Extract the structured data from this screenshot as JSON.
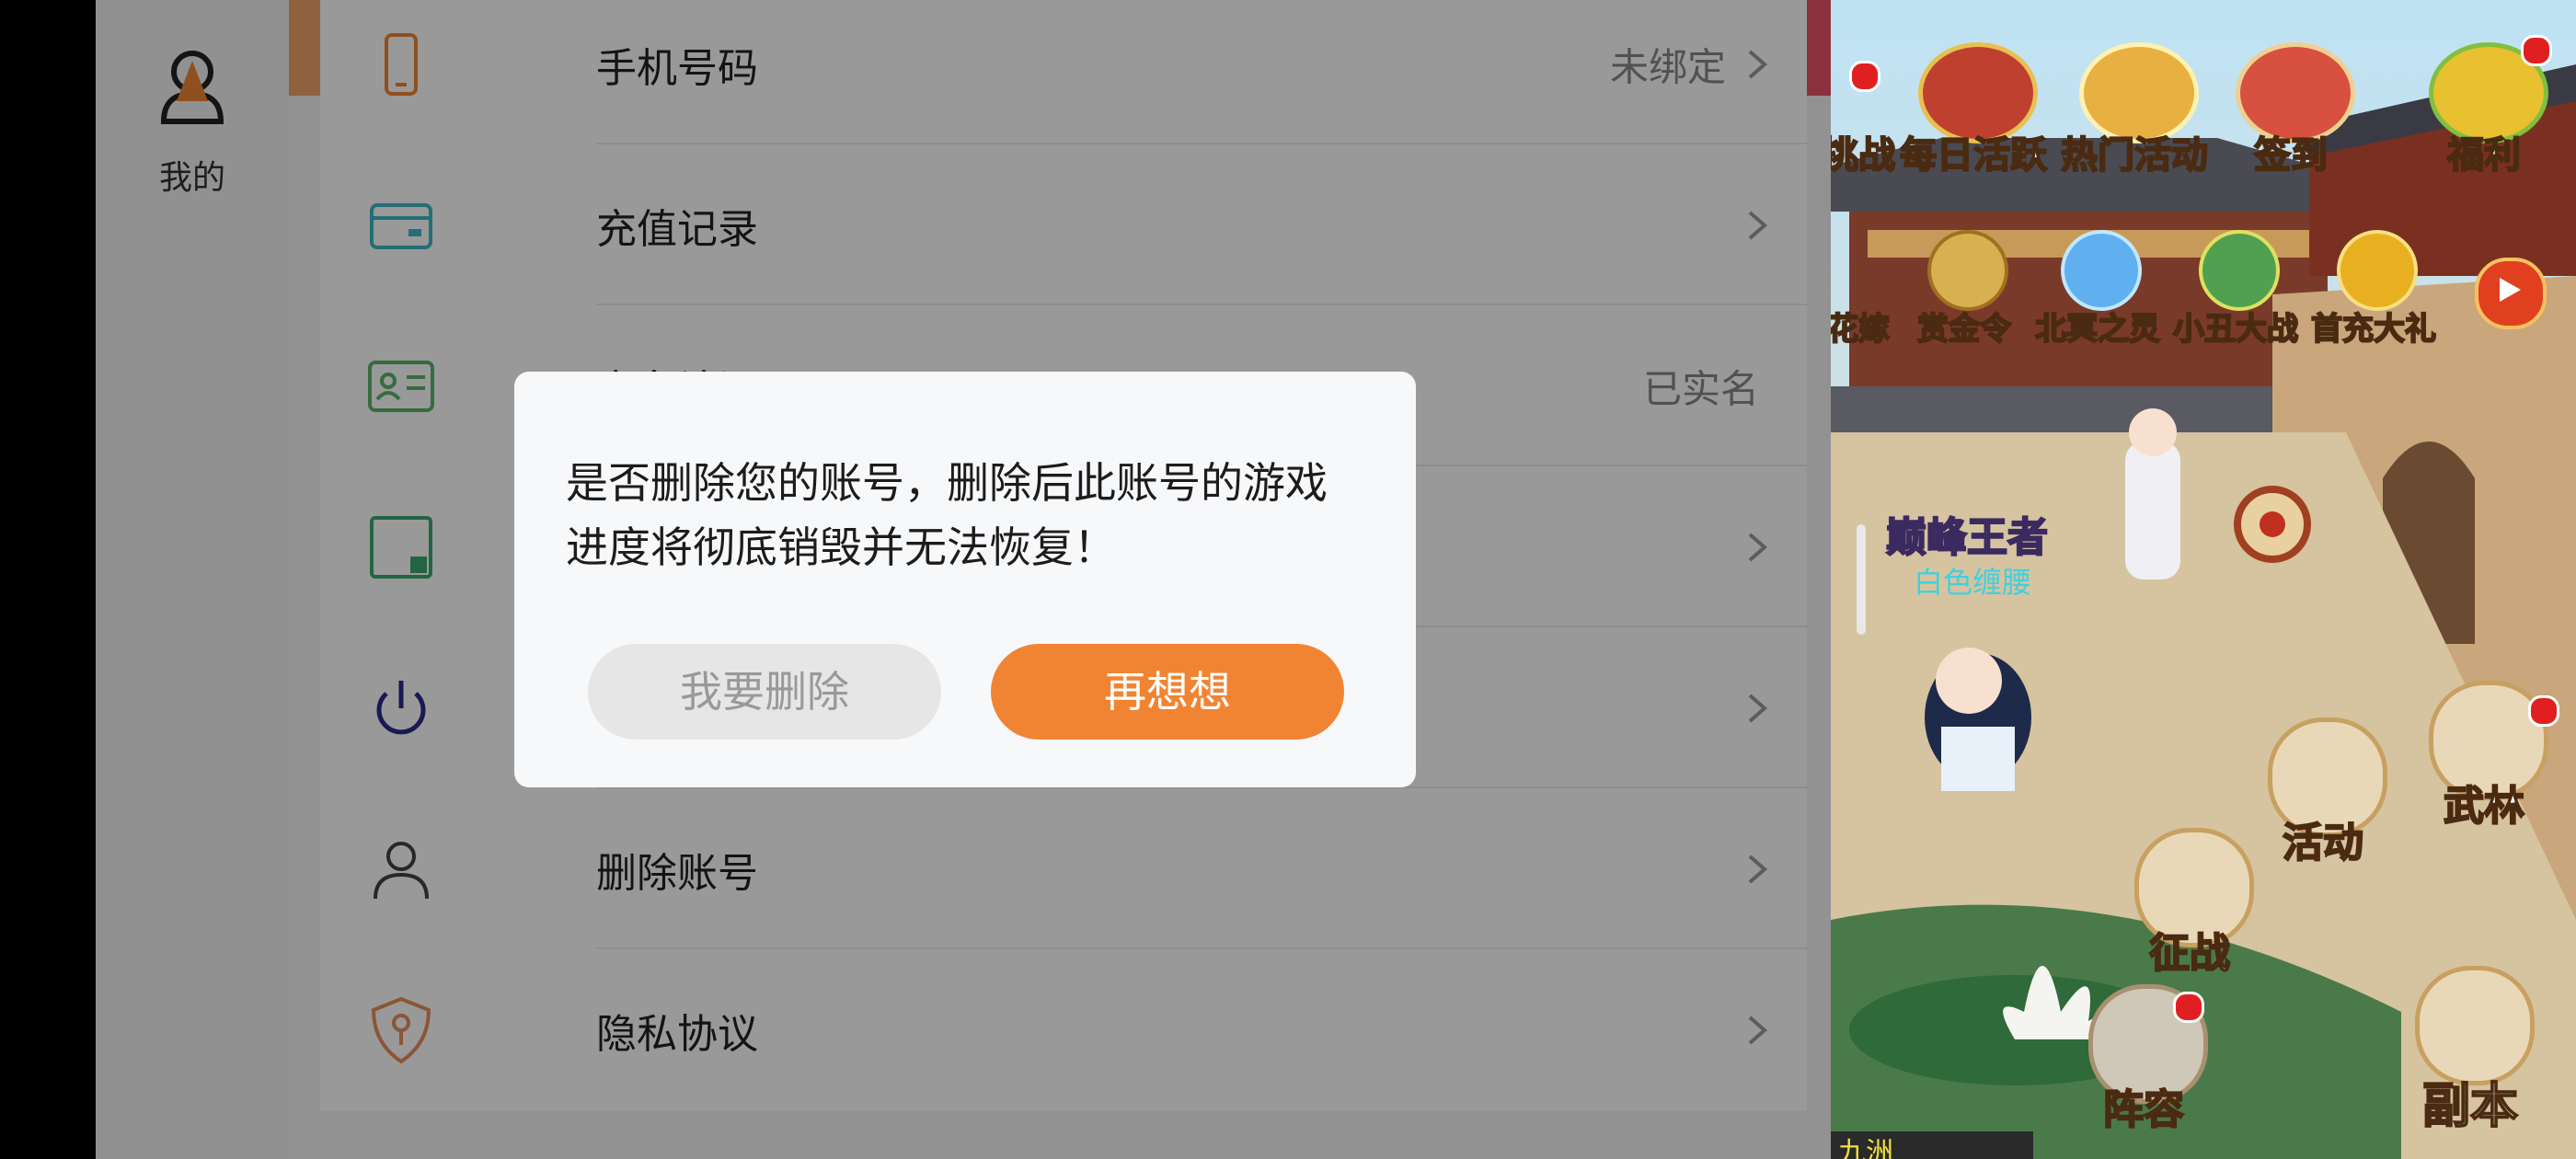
{
  "sidebar": {
    "me_label": "我的"
  },
  "settings": {
    "rows": [
      {
        "label": "手机号码",
        "value": "未绑定"
      },
      {
        "label": "充值记录",
        "value": ""
      },
      {
        "label": "实名认证",
        "value": "已实名"
      },
      {
        "label": "",
        "value": ""
      },
      {
        "label": "",
        "value": ""
      },
      {
        "label": "删除账号",
        "value": ""
      },
      {
        "label": "隐私协议",
        "value": ""
      }
    ]
  },
  "dialog": {
    "message": "是否删除您的账号，删除后此账号的游戏进度将彻底销毁并无法恢复！",
    "delete_label": "我要删除",
    "reconsider_label": "再想想"
  },
  "game": {
    "top_icons": [
      "挑战",
      "每日活跃",
      "热门活动",
      "签到",
      "福利"
    ],
    "second_icons": [
      "花嫁",
      "赏金令",
      "北冥之灵",
      "小丑大战",
      "首充大礼"
    ],
    "player_title": "巅峰王者",
    "player_name": "白色缠腰",
    "side_buttons": [
      "活动",
      "武林",
      "征战",
      "阵容",
      "副本"
    ],
    "region": "九洲"
  },
  "colors": {
    "accent": "#f18433",
    "overlay": "rgba(0,0,0,0.4)"
  }
}
